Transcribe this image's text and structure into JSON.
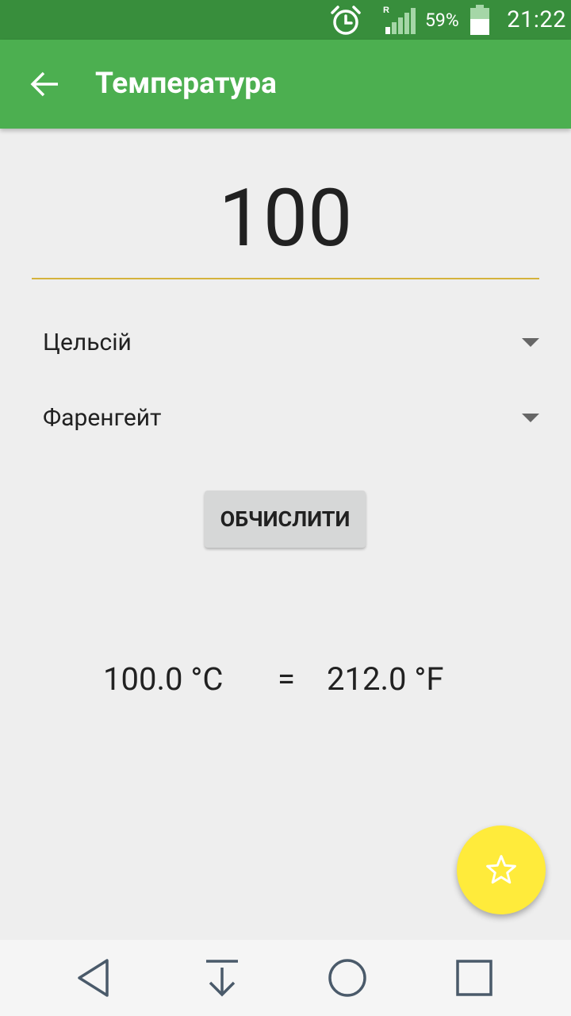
{
  "status_bar": {
    "battery_percent": "59%",
    "time": "21:22",
    "roaming_indicator": "R",
    "battery_level": 0.59,
    "icons": [
      "alarm-icon",
      "signal-icon",
      "battery-icon"
    ]
  },
  "app_bar": {
    "title": "Температура",
    "back_icon": "arrow-back-icon"
  },
  "input": {
    "value": "100"
  },
  "conversion": {
    "from_unit": "Цельсій",
    "to_unit": "Фаренгейт",
    "calculate_label": "ОБЧИСЛИТИ"
  },
  "result": {
    "from_value": "100.0 °C",
    "equals": "=",
    "to_value": "212.0 °F"
  },
  "fab": {
    "icon": "star-outline-icon"
  },
  "nav_bar": {
    "icons": [
      "nav-back-icon",
      "nav-download-icon",
      "nav-home-icon",
      "nav-recents-icon"
    ]
  },
  "colors": {
    "status_bar": "#388e3c",
    "app_bar": "#4caf50",
    "background": "#eeeeee",
    "accent_underline": "#d4b23c",
    "fab": "#ffeb3b",
    "button": "#d6d7d7",
    "nav_bar": "#f5f5f5"
  }
}
